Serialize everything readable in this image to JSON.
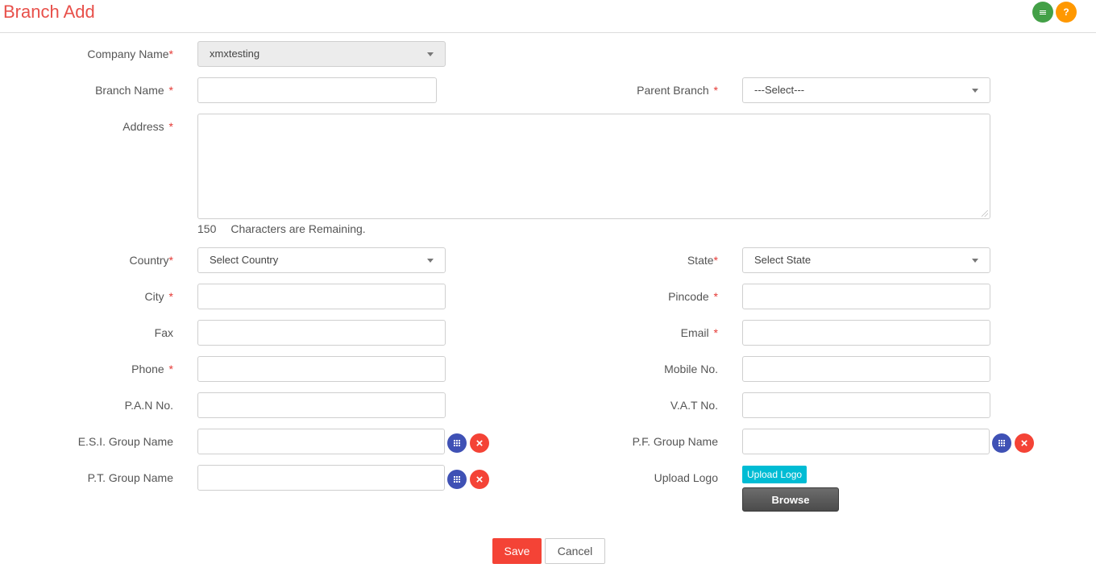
{
  "page": {
    "title": "Branch Add"
  },
  "header": {
    "list_icon": "list-icon",
    "help_label": "?"
  },
  "required_mark": "*",
  "form": {
    "company_name": {
      "label": "Company Name",
      "value": "xmxtesting"
    },
    "branch_name": {
      "label": "Branch Name",
      "value": ""
    },
    "parent_branch": {
      "label": "Parent Branch",
      "value": "---Select---"
    },
    "address": {
      "label": "Address",
      "value": ""
    },
    "chars_remaining": {
      "count": "150",
      "text": "Characters are Remaining."
    },
    "country": {
      "label": "Country",
      "value": "Select Country"
    },
    "state": {
      "label": "State",
      "value": "Select State"
    },
    "city": {
      "label": "City",
      "value": ""
    },
    "pincode": {
      "label": "Pincode",
      "value": ""
    },
    "fax": {
      "label": "Fax",
      "value": ""
    },
    "email": {
      "label": "Email",
      "value": ""
    },
    "phone": {
      "label": "Phone",
      "value": ""
    },
    "mobile_no": {
      "label": "Mobile No.",
      "value": ""
    },
    "pan_no": {
      "label": "P.A.N No.",
      "value": ""
    },
    "vat_no": {
      "label": "V.A.T No.",
      "value": ""
    },
    "esi_group_name": {
      "label": "E.S.I. Group Name",
      "value": ""
    },
    "pf_group_name": {
      "label": "P.F. Group Name",
      "value": ""
    },
    "pt_group_name": {
      "label": "P.T. Group Name",
      "value": ""
    },
    "upload_logo": {
      "label": "Upload Logo",
      "button_label": "Upload Logo",
      "browse_label": "Browse"
    }
  },
  "actions": {
    "save_label": "Save",
    "cancel_label": "Cancel"
  },
  "icons": {
    "clear": "×"
  },
  "colors": {
    "title": "#e8504a",
    "required": "#e53935",
    "save": "#f44336",
    "grid_button": "#3f51b5",
    "clear_button": "#f44336",
    "upload": "#00bcd4",
    "list_button": "#43a047",
    "help_button": "#ff9800"
  }
}
